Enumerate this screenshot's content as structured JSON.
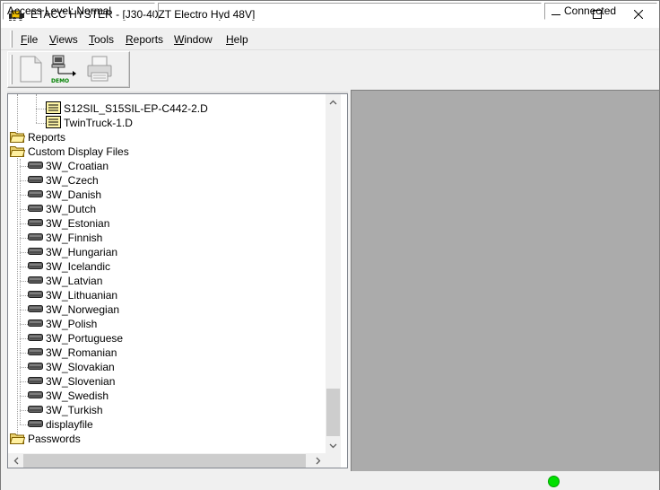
{
  "window": {
    "title": "ETACC HYSTER - [J30-40ZT Electro Hyd 48V]",
    "controls": [
      "minimize",
      "maximize",
      "close"
    ]
  },
  "menu": {
    "items": [
      {
        "label": "File",
        "ul": "F",
        "rest": "ile"
      },
      {
        "label": "Views",
        "ul": "V",
        "rest": "iews"
      },
      {
        "label": "Tools",
        "ul": "T",
        "rest": "ools"
      },
      {
        "label": "Reports",
        "ul": "R",
        "rest": "eports"
      },
      {
        "label": "Window",
        "ul": "W",
        "rest": "indow"
      },
      {
        "label": "Help",
        "ul": "H",
        "rest": "elp"
      }
    ]
  },
  "toolbar": {
    "buttons": [
      {
        "icon": "new-document-icon"
      },
      {
        "icon": "demo-computer-icon",
        "badge": "DEMO"
      },
      {
        "icon": "printer-icon"
      }
    ]
  },
  "tree": {
    "items": [
      {
        "label": "S12SIL_S15SIL-EP-C442-2.D",
        "icon": "file-folder-icon",
        "level": 2,
        "selected": false
      },
      {
        "label": "TwinTruck-1.D",
        "icon": "file-folder-icon",
        "level": 2
      },
      {
        "label": "Reports",
        "icon": "open-folder-icon",
        "level": 0
      },
      {
        "label": "Custom Display Files",
        "icon": "open-folder-icon",
        "level": 0
      },
      {
        "label": "3W_Croatian",
        "icon": "display-file-icon",
        "level": 1
      },
      {
        "label": "3W_Czech",
        "icon": "display-file-icon",
        "level": 1
      },
      {
        "label": "3W_Danish",
        "icon": "display-file-icon",
        "level": 1
      },
      {
        "label": "3W_Dutch",
        "icon": "display-file-icon",
        "level": 1
      },
      {
        "label": "3W_Estonian",
        "icon": "display-file-icon",
        "level": 1
      },
      {
        "label": "3W_Finnish",
        "icon": "display-file-icon",
        "level": 1
      },
      {
        "label": "3W_Hungarian",
        "icon": "display-file-icon",
        "level": 1
      },
      {
        "label": "3W_Icelandic",
        "icon": "display-file-icon",
        "level": 1
      },
      {
        "label": "3W_Latvian",
        "icon": "display-file-icon",
        "level": 1
      },
      {
        "label": "3W_Lithuanian",
        "icon": "display-file-icon",
        "level": 1
      },
      {
        "label": "3W_Norwegian",
        "icon": "display-file-icon",
        "level": 1
      },
      {
        "label": "3W_Polish",
        "icon": "display-file-icon",
        "level": 1
      },
      {
        "label": "3W_Portuguese",
        "icon": "display-file-icon",
        "level": 1
      },
      {
        "label": "3W_Romanian",
        "icon": "display-file-icon",
        "level": 1
      },
      {
        "label": "3W_Slovakian",
        "icon": "display-file-icon",
        "level": 1
      },
      {
        "label": "3W_Slovenian",
        "icon": "display-file-icon",
        "level": 1
      },
      {
        "label": "3W_Swedish",
        "icon": "display-file-icon",
        "level": 1
      },
      {
        "label": "3W_Turkish",
        "icon": "display-file-icon",
        "level": 1
      },
      {
        "label": "displayfile",
        "icon": "display-file-icon",
        "level": 1
      },
      {
        "label": "Passwords",
        "icon": "open-folder-icon",
        "level": 0
      }
    ]
  },
  "status": {
    "access_level": "Access Level: Normal",
    "middle": "",
    "connection": "Connected",
    "connection_color": "#00e000"
  },
  "colors": {
    "workspace": "#ababab",
    "chrome": "#f0f0f0"
  }
}
